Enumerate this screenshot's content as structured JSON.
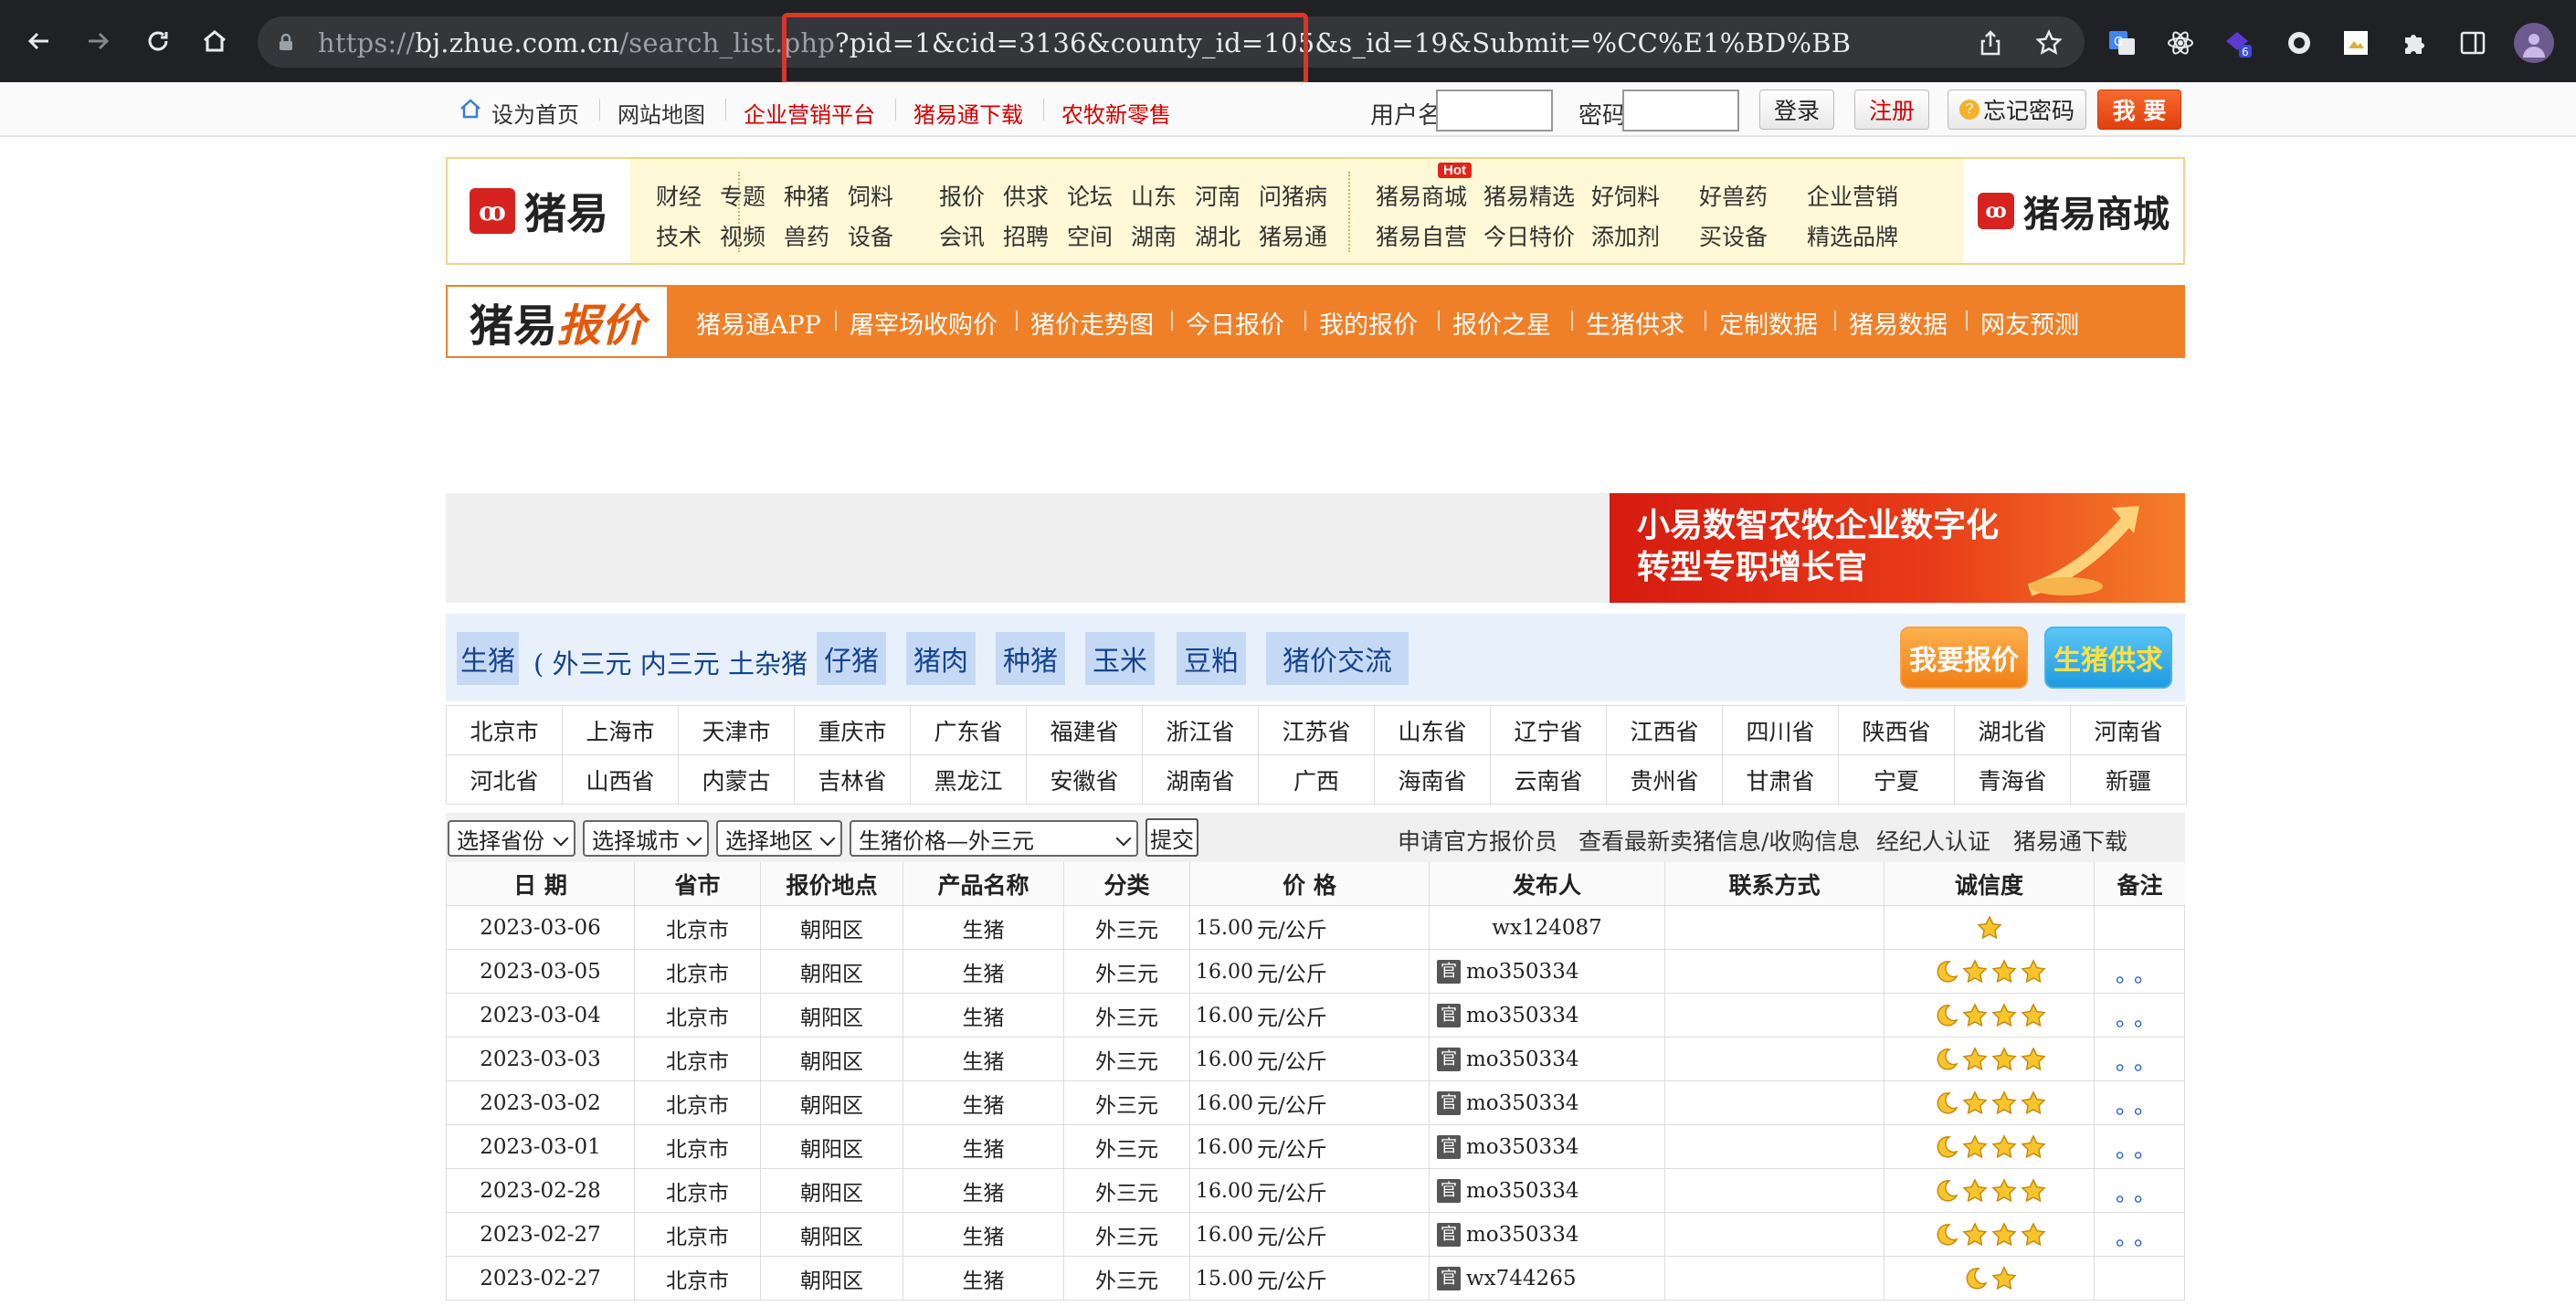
{
  "browser": {
    "url_prefix": "https://",
    "url_host": "bj.zhue.com.cn",
    "url_path": "/search_list.php",
    "url_query": "?pid=1&cid=3136&county_id=105&s_id=19",
    "url_tail": "&Submit=%CC%E1%BD%BB",
    "ext_badge": "6"
  },
  "topbar": {
    "home": "设为首页",
    "sitemap": "网站地图",
    "enterprise": "企业营销平台",
    "app_download": "猪易通下载",
    "retail": "农牧新零售",
    "username_label": "用户名",
    "password_label": "密码",
    "login": "登录",
    "register": "注册",
    "forgot": "忘记密码",
    "want": "我 要"
  },
  "header": {
    "logo": "猪易",
    "logo_mark": "ꝏ",
    "mall_logo": "猪易商城",
    "hot": "Hot",
    "group1_row1": [
      "财经",
      "专题",
      "种猪",
      "饲料"
    ],
    "group1_row2": [
      "技术",
      "视频",
      "兽药",
      "设备"
    ],
    "group2_row1": [
      "报价",
      "供求",
      "论坛",
      "山东",
      "河南",
      "问猪病"
    ],
    "group2_row2": [
      "会讯",
      "招聘",
      "空间",
      "湖南",
      "湖北",
      "猪易通"
    ],
    "group3_row1": [
      "猪易商城",
      "猪易精选",
      "好饲料",
      "好兽药",
      "企业营销"
    ],
    "group3_row2": [
      "猪易自营",
      "今日特价",
      "添加剂",
      "买设备",
      "精选品牌"
    ]
  },
  "orangebar": {
    "logo_a": "猪易",
    "logo_b": "报价",
    "items": [
      "猪易通APP",
      "屠宰场收购价",
      "猪价走势图",
      "今日报价",
      "我的报价",
      "报价之星",
      "生猪供求",
      "定制数据",
      "猪易数据",
      "网友预测"
    ]
  },
  "banner": {
    "line1": "小易数智农牧企业数字化",
    "line2": "转型专职增长官"
  },
  "categories": {
    "main": "生猪",
    "sub": "( 外三元 内三元 土杂猪 )",
    "items": [
      "仔猪",
      "猪肉",
      "种猪",
      "玉米",
      "豆粕",
      "猪价交流"
    ],
    "report_btn": "我要报价",
    "supply_btn": "生猪供求"
  },
  "provinces": [
    [
      "北京市",
      "上海市",
      "天津市",
      "重庆市",
      "广东省",
      "福建省",
      "浙江省",
      "江苏省",
      "山东省",
      "辽宁省",
      "江西省",
      "四川省",
      "陕西省",
      "湖北省",
      "河南省"
    ],
    [
      "河北省",
      "山西省",
      "内蒙古",
      "吉林省",
      "黑龙江",
      "安徽省",
      "湖南省",
      "广西",
      "海南省",
      "云南省",
      "贵州省",
      "甘肃省",
      "宁夏",
      "青海省",
      "新疆"
    ]
  ],
  "filters": {
    "province": "选择省份",
    "city": "选择城市",
    "district": "选择地区",
    "price": "生猪价格—外三元",
    "submit": "提交",
    "links": [
      "申请官方报价员",
      "查看最新卖猪信息/收购信息",
      "经纪人认证",
      "猪易通下载"
    ]
  },
  "table": {
    "headers": [
      "日 期",
      "省市",
      "报价地点",
      "产品名称",
      "分类",
      "价 格",
      "发布人",
      "联系方式",
      "诚信度",
      "备注"
    ],
    "unit": "元/公斤",
    "gov_mark": "官",
    "rows": [
      {
        "date": "2023-03-06",
        "city": "北京市",
        "place": "朝阳区",
        "product": "生猪",
        "type": "外三元",
        "price": "15.00",
        "publisher": "wx124087",
        "official": false,
        "rating": "star1",
        "note": ""
      },
      {
        "date": "2023-03-05",
        "city": "北京市",
        "place": "朝阳区",
        "product": "生猪",
        "type": "外三元",
        "price": "16.00",
        "publisher": "mo350334",
        "official": true,
        "rating": "moon3",
        "note": "。。"
      },
      {
        "date": "2023-03-04",
        "city": "北京市",
        "place": "朝阳区",
        "product": "生猪",
        "type": "外三元",
        "price": "16.00",
        "publisher": "mo350334",
        "official": true,
        "rating": "moon3",
        "note": "。。"
      },
      {
        "date": "2023-03-03",
        "city": "北京市",
        "place": "朝阳区",
        "product": "生猪",
        "type": "外三元",
        "price": "16.00",
        "publisher": "mo350334",
        "official": true,
        "rating": "moon3",
        "note": "。。"
      },
      {
        "date": "2023-03-02",
        "city": "北京市",
        "place": "朝阳区",
        "product": "生猪",
        "type": "外三元",
        "price": "16.00",
        "publisher": "mo350334",
        "official": true,
        "rating": "moon3",
        "note": "。。"
      },
      {
        "date": "2023-03-01",
        "city": "北京市",
        "place": "朝阳区",
        "product": "生猪",
        "type": "外三元",
        "price": "16.00",
        "publisher": "mo350334",
        "official": true,
        "rating": "moon3",
        "note": "。。"
      },
      {
        "date": "2023-02-28",
        "city": "北京市",
        "place": "朝阳区",
        "product": "生猪",
        "type": "外三元",
        "price": "16.00",
        "publisher": "mo350334",
        "official": true,
        "rating": "moon3",
        "note": "。。"
      },
      {
        "date": "2023-02-27",
        "city": "北京市",
        "place": "朝阳区",
        "product": "生猪",
        "type": "外三元",
        "price": "16.00",
        "publisher": "mo350334",
        "official": true,
        "rating": "moon3",
        "note": "。。"
      },
      {
        "date": "2023-02-27",
        "city": "北京市",
        "place": "朝阳区",
        "product": "生猪",
        "type": "外三元",
        "price": "15.00",
        "publisher": "wx744265",
        "official": true,
        "rating": "moon1",
        "note": ""
      }
    ]
  },
  "colors": {
    "orange": "#f08028",
    "brand_red": "#d6231f",
    "link_blue": "#14438e",
    "highlight": "#d9362b"
  }
}
